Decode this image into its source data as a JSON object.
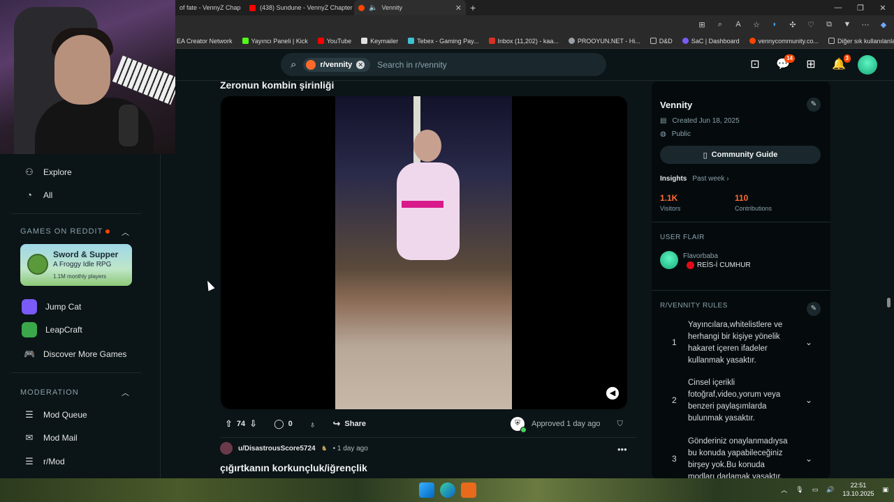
{
  "browser": {
    "tabs": [
      {
        "title": "of fate - VennyZ Chap",
        "favicon_color": "#ff4500"
      },
      {
        "title": "(438) Sundune - VennyZ Chapter",
        "favicon_color": "#ff0000"
      },
      {
        "title": "Vennity",
        "favicon_color": "#ff4500",
        "active": true
      }
    ],
    "bookmarks": [
      {
        "label": "EA Creator Network",
        "color": "#ff4747"
      },
      {
        "label": "Yayıncı Paneli | Kick",
        "color": "#53fc18"
      },
      {
        "label": "YouTube",
        "color": "#ff0000"
      },
      {
        "label": "Keymailer",
        "color": "#e0e0e0"
      },
      {
        "label": "Tebex - Gaming Pay...",
        "color": "#3ec1d3"
      },
      {
        "label": "Inbox (11,202) - kaa...",
        "color": "#d93025"
      },
      {
        "label": "PROOYUN.NET - Hi...",
        "color": "#9aa0a6"
      },
      {
        "label": "D&D",
        "color": "#c0c0c0"
      },
      {
        "label": "SaC | Dashboard",
        "color": "#7a5af8"
      },
      {
        "label": "vennycommunity.co...",
        "color": "#ff4500"
      }
    ],
    "other_bookmarks": "Diğer sık kullanılanlar"
  },
  "header": {
    "subreddit_chip": "r/vennity",
    "search_placeholder": "Search in r/vennity",
    "chat_badge": "14",
    "notif_badge": "3"
  },
  "leftnav": {
    "explore": "Explore",
    "all": "All",
    "games_label": "GAMES ON REDDIT",
    "game_card": {
      "title": "Sword & Supper",
      "subtitle": "A Froggy Idle RPG",
      "players": "1.1M monthly players"
    },
    "games": [
      {
        "label": "Jump Cat",
        "color": "#7a5af8"
      },
      {
        "label": "LeapCraft",
        "color": "#3aa84a"
      },
      {
        "label": "Discover More Games"
      }
    ],
    "moderation_label": "MODERATION",
    "mod_items": [
      "Mod Queue",
      "Mod Mail",
      "r/Mod"
    ]
  },
  "post": {
    "title": "Zeronun kombin şirinliği",
    "score": "74",
    "comments": "0",
    "share": "Share",
    "approved": "Approved 1 day ago"
  },
  "post2": {
    "user": "u/DisastrousScore5724",
    "time": "• 1 day ago",
    "title": "çığırtkanın korkunçluk/iğrençlik"
  },
  "sidebar": {
    "name": "Vennity",
    "created": "Created Jun 18, 2025",
    "visibility": "Public",
    "guide_button": "Community Guide",
    "insights_label": "Insights",
    "insights_period": "Past week ›",
    "visitors_value": "1.1K",
    "visitors_label": "Visitors",
    "contrib_value": "110",
    "contrib_label": "Contributions",
    "flair_label": "USER FLAIR",
    "flair_user": "Flavorbaba",
    "flair_tag": "REİS-İ CUMHUR",
    "rules_label": "R/VENNITY RULES",
    "rules": [
      {
        "num": "1",
        "text": "Yayıncılara,whitelistlere ve herhangi bir kişiye yönelik hakaret içeren ifadeler kullanmak yasaktır."
      },
      {
        "num": "2",
        "text": "Cinsel içerikli fotoğraf,video,yorum veya benzeri paylaşımlarda bulunmak yasaktır."
      },
      {
        "num": "3",
        "text": "Gönderiniz onaylanmadıysa bu konuda yapabileceğiniz birşey yok.Bu konuda modları darlamak yasaktır."
      }
    ]
  },
  "taskbar": {
    "time": "22:51",
    "date": "13.10.2025"
  }
}
